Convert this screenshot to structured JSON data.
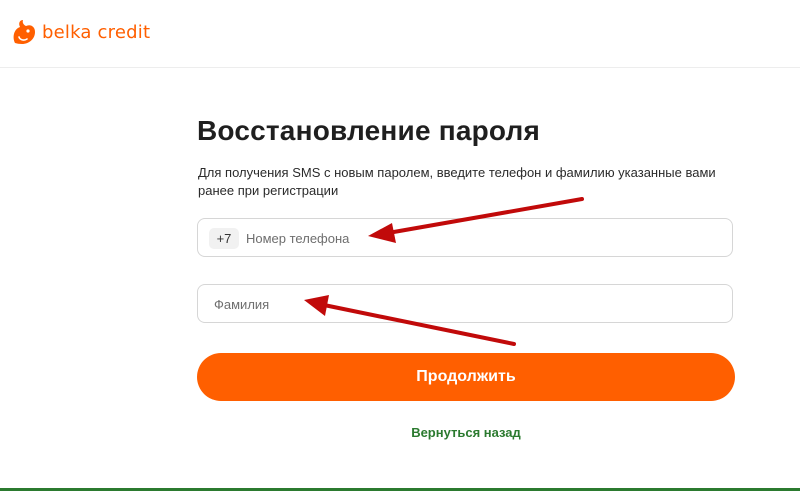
{
  "brand": {
    "name": "belka credit",
    "logo_icon": "squirrel-logo-icon",
    "color": "#ff5f00"
  },
  "form": {
    "title": "Восстановление пароля",
    "description": "Для получения SMS с новым паролем, введите телефон и фамилию указанные вами ранее при регистрации",
    "phone": {
      "prefix": "+7",
      "placeholder": "Номер телефона",
      "value": ""
    },
    "surname": {
      "placeholder": "Фамилия",
      "value": ""
    },
    "submit_label": "Продолжить",
    "back_label": "Вернуться назад"
  },
  "colors": {
    "accent": "#ff5f00",
    "link": "#2b7a2f",
    "annotation_arrow": "#c10a0a"
  }
}
